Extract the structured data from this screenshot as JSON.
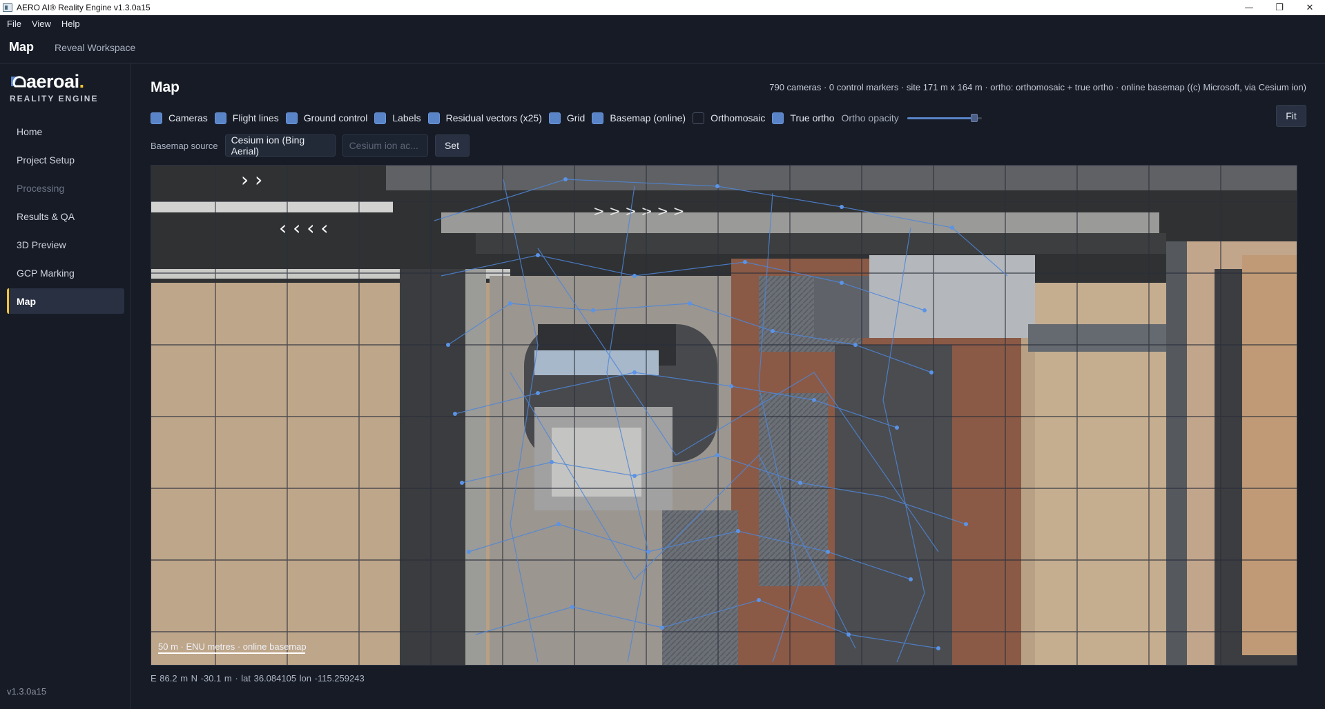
{
  "window": {
    "title": "AERO AI® Reality Engine v1.3.0a15",
    "controls": {
      "minimize": "—",
      "maximize": "❐",
      "close": "✕"
    }
  },
  "menu": {
    "file": "File",
    "view": "View",
    "help": "Help"
  },
  "tabs": {
    "active": "Map",
    "other": "Reveal Workspace"
  },
  "brand": {
    "word": "aero",
    "word_ai": "ai",
    "dot": ".",
    "subtitle": "REALITY ENGINE"
  },
  "sidebar": {
    "items": [
      {
        "label": "Home"
      },
      {
        "label": "Project Setup"
      },
      {
        "label": "Processing"
      },
      {
        "label": "Results & QA"
      },
      {
        "label": "3D Preview"
      },
      {
        "label": "GCP Marking"
      },
      {
        "label": "Map"
      }
    ],
    "version": "v1.3.0a15"
  },
  "page": {
    "title": "Map",
    "status": "790 cameras · 0 control markers · site 171 m x 164 m · ortho: orthomosaic + true ortho · online basemap ((c) Microsoft, via Cesium ion)"
  },
  "layers": {
    "cameras": {
      "label": "Cameras",
      "checked": true
    },
    "flight_lines": {
      "label": "Flight lines",
      "checked": true
    },
    "ground_control": {
      "label": "Ground control",
      "checked": true
    },
    "labels": {
      "label": "Labels",
      "checked": true
    },
    "residual_vectors": {
      "label": "Residual vectors (x25)",
      "checked": true
    },
    "grid": {
      "label": "Grid",
      "checked": true
    },
    "basemap": {
      "label": "Basemap (online)",
      "checked": true
    },
    "orthomosaic": {
      "label": "Orthomosaic",
      "checked": false
    },
    "true_ortho": {
      "label": "True ortho",
      "checked": true
    }
  },
  "ortho_opacity": {
    "label": "Ortho opacity",
    "value": 0.9
  },
  "fit_label": "Fit",
  "basemap": {
    "label": "Basemap source",
    "selected": "Cesium ion (Bing Aerial)",
    "token_placeholder": "Cesium ion ac...",
    "set_label": "Set"
  },
  "map": {
    "scale_label": "50 m · ENU metres · online basemap"
  },
  "coords": "E 86.2 m   N -30.1 m   ·   lat 36.084105   lon -115.259243",
  "colors": {
    "accent": "#f4c430",
    "checkbox": "#5a84c8",
    "background": "#161b26"
  }
}
